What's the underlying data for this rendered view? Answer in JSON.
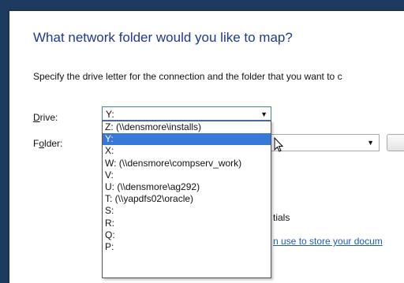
{
  "dialog": {
    "heading": "What network folder would you like to map?",
    "description": "Specify the drive letter for the connection and the folder that you want to c"
  },
  "drive": {
    "label_underlined": "D",
    "label_rest": "rive:",
    "selected": "Y:",
    "options": [
      "Z: (\\\\densmore\\installs)",
      "Y:",
      "X:",
      "W: (\\\\densmore\\compserv_work)",
      "V:",
      "U: (\\\\densmore\\ag292)",
      "T: (\\\\yapdfs02\\oracle)",
      "S:",
      "R:",
      "Q:",
      "P:"
    ],
    "selected_index": 1
  },
  "folder": {
    "label_pre": "F",
    "label_underlined": "o",
    "label_rest": "lder:",
    "value": ""
  },
  "partial": {
    "credentials_text": "tials",
    "link_text": "n use to store your docum"
  },
  "colors": {
    "heading": "#1e3a8c",
    "selection": "#3878d8",
    "link": "#1e5bb8"
  }
}
